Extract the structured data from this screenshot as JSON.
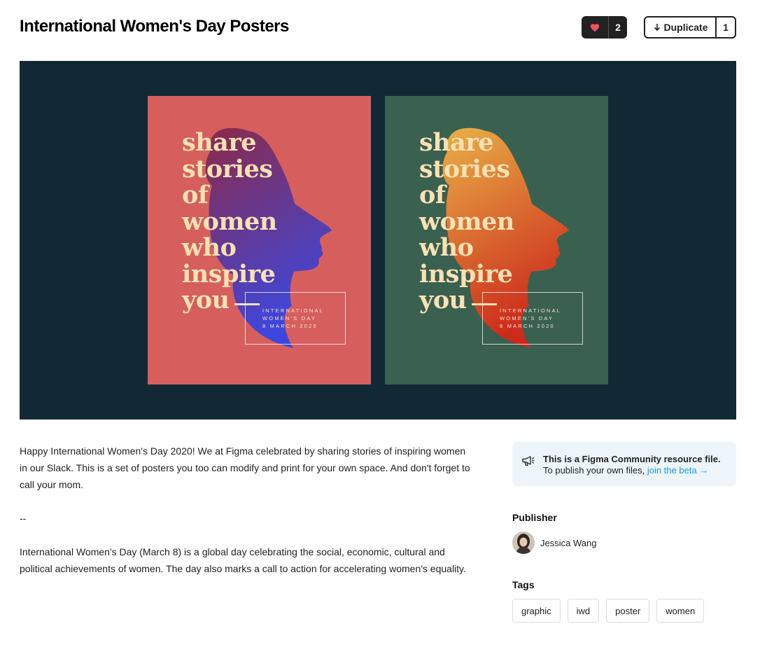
{
  "header": {
    "title": "International Women's Day Posters",
    "like_count": "2",
    "duplicate_label": "Duplicate",
    "duplicate_count": "1"
  },
  "posters": [
    {
      "lines": [
        "share",
        "stories",
        "of",
        "women",
        "who",
        "inspire",
        "you"
      ],
      "box_lines": [
        "INTERNATIONAL",
        "WOMEN'S DAY",
        "8 MARCH 2020"
      ],
      "bg": "#d65f5e",
      "gradient_top": "#8c2a48",
      "gradient_bottom": "#3d47de"
    },
    {
      "lines": [
        "share",
        "stories",
        "of",
        "women",
        "who",
        "inspire",
        "you"
      ],
      "box_lines": [
        "INTERNATIONAL",
        "WOMEN'S DAY",
        "8 MARCH 2020"
      ],
      "bg": "#3a6050",
      "gradient_top": "#e9b147",
      "gradient_bottom": "#cc2a1c"
    }
  ],
  "description": {
    "p1": "Happy International Women's Day 2020! We at Figma celebrated by sharing stories of inspiring women in our Slack. This is a set of posters you too can modify and print for your own space. And don't forget to call your mom.",
    "p2": "--",
    "p3": "International Women's Day (March 8) is a global day celebrating the social, economic, cultural and political achievements of women. The day also marks a call to action for accelerating women's equality."
  },
  "notice": {
    "line1": "This is a Figma Community resource file.",
    "line2_prefix": "To publish your own files,",
    "link": "join the beta →"
  },
  "publisher": {
    "heading": "Publisher",
    "name": "Jessica Wang"
  },
  "tags": {
    "heading": "Tags",
    "items": [
      "graphic",
      "iwd",
      "poster",
      "women"
    ]
  },
  "colors": {
    "hero_bg": "#132835",
    "accent_link": "#1b98e0",
    "heart": "#f0525e"
  }
}
